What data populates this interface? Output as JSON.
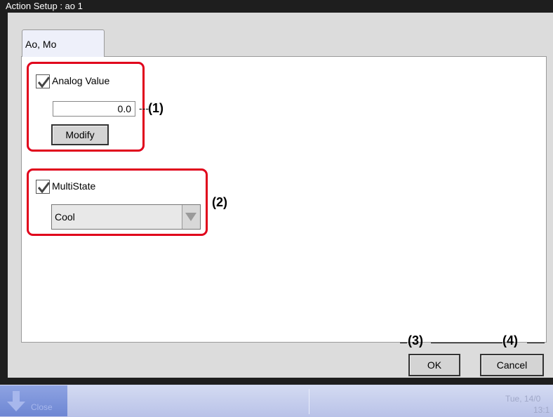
{
  "window": {
    "title": "Action Setup : ao 1"
  },
  "tabs": [
    {
      "label": "Ao, Mo"
    }
  ],
  "analog": {
    "checkbox_label": "Analog Value",
    "checked": true,
    "value": "0.0",
    "unit": "---",
    "modify_label": "Modify",
    "callout": "(1)"
  },
  "multistate": {
    "checkbox_label": "MultiState",
    "checked": true,
    "selected": "Cool",
    "callout": "(2)"
  },
  "footer": {
    "ok_label": "OK",
    "cancel_label": "Cancel",
    "ok_callout": "(3)",
    "cancel_callout": "(4)"
  },
  "taskbar": {
    "button_label": "Close",
    "date": "Tue, 14/0",
    "time": "13:1"
  },
  "colors": {
    "callout_border": "#e0001b",
    "title_bar": "#1e1e1e",
    "taskbar": "#c4cbee"
  },
  "icons": {
    "check": "check-icon",
    "dropdown": "dropdown-arrow-icon",
    "taskbar": "down-arrow-icon"
  }
}
